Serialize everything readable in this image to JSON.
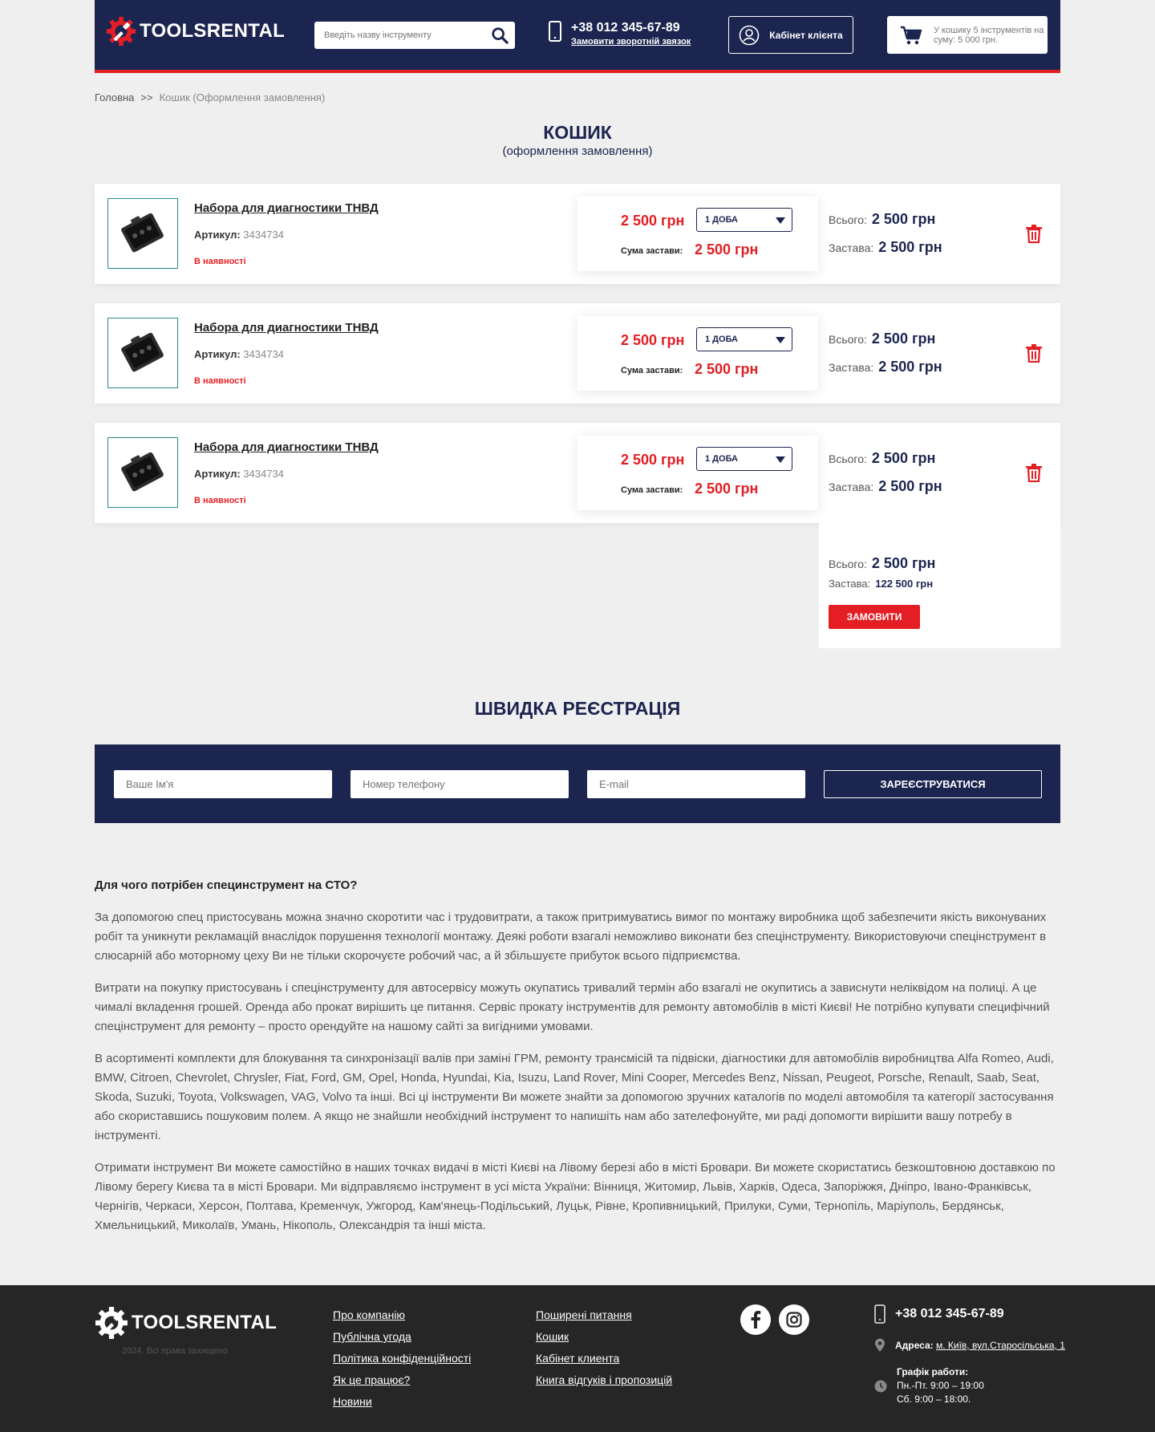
{
  "header": {
    "logo_text": "TOOLSRENTAL",
    "search_placeholder": "Введіть назву інструменту",
    "phone": "+38 012 345-67-89",
    "callback_label": "Замовити зворотній звязок",
    "cabinet_label": "Кабінет клієнта",
    "cart_text": "У кошику 5 інструментів на суму: 5 000 грн."
  },
  "breadcrumb": {
    "home": "Головна",
    "separator": ">>",
    "current": "Кошик (Оформлення замовлення)"
  },
  "page": {
    "title": "КОШИК",
    "subtitle": "(оформлення замовлення)"
  },
  "cart": {
    "items": [
      {
        "title": "Набора для диагностики ТНВД",
        "sku_label": "Артикул:",
        "sku": "3434734",
        "stock": "В наявності",
        "price": "2 500 грн",
        "period": "1 ДОБА",
        "deposit_label": "Сума застави:",
        "deposit": "2 500 грн",
        "total_label": "Всього:",
        "total": "2 500 грн",
        "pledge_label": "Застава:",
        "pledge": "2 500 грн"
      },
      {
        "title": "Набора для диагностики ТНВД",
        "sku_label": "Артикул:",
        "sku": "3434734",
        "stock": "В наявності",
        "price": "2 500 грн",
        "period": "1 ДОБА",
        "deposit_label": "Сума застави:",
        "deposit": "2 500 грн",
        "total_label": "Всього:",
        "total": "2 500 грн",
        "pledge_label": "Застава:",
        "pledge": "2 500 грн"
      },
      {
        "title": "Набора для диагностики ТНВД",
        "sku_label": "Артикул:",
        "sku": "3434734",
        "stock": "В наявності",
        "price": "2 500 грн",
        "period": "1 ДОБА",
        "deposit_label": "Сума застави:",
        "deposit": "2 500 грн",
        "total_label": "Всього:",
        "total": "2 500 грн",
        "pledge_label": "Застава:",
        "pledge": "2 500 грн"
      }
    ],
    "summary": {
      "total_label": "Всього:",
      "total": "2 500 грн",
      "pledge_label": "Застава:",
      "pledge": "122 500 грн",
      "order_button": "ЗАМОВИТИ"
    }
  },
  "registration": {
    "title": "ШВИДКА РЕЄСТРАЦІЯ",
    "name_placeholder": "Ваше Ім'я",
    "phone_placeholder": "Номер телефону",
    "email_placeholder": "E-mail",
    "submit_label": "ЗАРЕЄСТРУВАТИСЯ"
  },
  "article": {
    "heading": "Для чого потрібен специнструмент на СТО?",
    "paragraphs": [
      "За допомогою спец пристосувань можна значно скоротити час і трудовитрати, а також притримуватись вимог по монтажу виробника щоб забезпечити якість виконуваних робіт та уникнути рекламацій внаслідок порушення технології монтажу. Деякі роботи взагалі неможливо виконати без спецінструменту. Використовуючи спецінструмент в слюсарній або моторному цеху Ви не тільки скорочуєте робочий час, а й збільшуєте прибуток всього підприємства.",
      "Витрати на покупку пристосувань і спецінструменту для автосервісу можуть окупатись тривалий термін або взагалі не окупитись а зависнути неліквідом на полиці. А це чималі вкладення грошей. Оренда або прокат вирішить це питання. Сервіс прокату інструментів для ремонту автомобілів в місті Києві! Не потрібно купувати специфічний спецінструмент для ремонту – просто орендуйте на нашому сайті за вигідними умовами.",
      "В асортименті комплекти для блокування та синхронізації валів при заміні ГРМ, ремонту трансмісій та підвіски, діагностики для автомобілів виробництва Alfa Romeo, Audi, BMW, Citroen, Chevrolet, Chrysler, Fiat, Ford, GM, Opel, Honda, Hyundai, Kia, Isuzu, Land Rover, Mini Cooper, Mercedes Benz, Nissan, Peugeot, Porsche, Renault, Saab, Seat, Skoda, Suzuki, Toyota, Volkswagen, VAG, Volvo та інші. Всі ці інструменти Ви можете знайти за допомогою зручних каталогів по моделі автомобіля та категорії застосування або скориставшись пошуковим полем. А якщо не знайшли необхідний інструмент то напишіть нам або зателефонуйте, ми раді допомогти вирішити вашу потребу в інструменті.",
      "Отримати інструмент Ви можете самостійно в наших точках видачі в місті Києві на Лівому березі або в місті Бровари. Ви можете скористатись безкоштовною доставкою по Лівому берегу Києва та в місті Бровари. Ми відправляємо інструмент в усі міста України: Вінниця, Житомир, Львів, Харків, Одеса, Запоріжжя, Дніпро, Івано-Франківськ, Чернігів, Черкаси, Херсон, Полтава, Кременчук, Ужгород, Кам'янець-Подільський, Луцьк, Рівне, Кропивницький, Прилуки, Суми, Тернопіль, Маріуполь, Бердянськ, Хмельницький, Миколаїв, Умань, Нікополь, Олександрія та інші міста."
    ]
  },
  "footer": {
    "logo_text": "TOOLSRENTAL",
    "copyright": "2024. Всі права захищено",
    "col1": [
      "Про компанію",
      "Публічна угода",
      "Політика конфіденційності",
      "Як це працює?",
      "Новини"
    ],
    "col2": [
      "Поширені питання",
      "Кошик",
      "Кабінет клиента",
      "Книга відгуків і пропозицій"
    ],
    "phone": "+38 012 345-67-89",
    "address_label": "Адреса:",
    "address": "м. Київ, вул.Старосільська, 1",
    "schedule_label": "Графік работи:",
    "schedule_weekdays": "Пн.-Пт. 9:00 – 19:00",
    "schedule_saturday": "Сб. 9:00 – 18:00."
  },
  "colors": {
    "brand_navy": "#1c2550",
    "accent_red": "#e31e24",
    "footer_bg": "#262626"
  },
  "icons": [
    "gear-wrench-logo-icon",
    "search-icon",
    "mobile-phone-icon",
    "user-icon",
    "cart-icon",
    "trash-icon",
    "facebook-icon",
    "instagram-icon",
    "location-pin-icon",
    "clock-icon"
  ]
}
